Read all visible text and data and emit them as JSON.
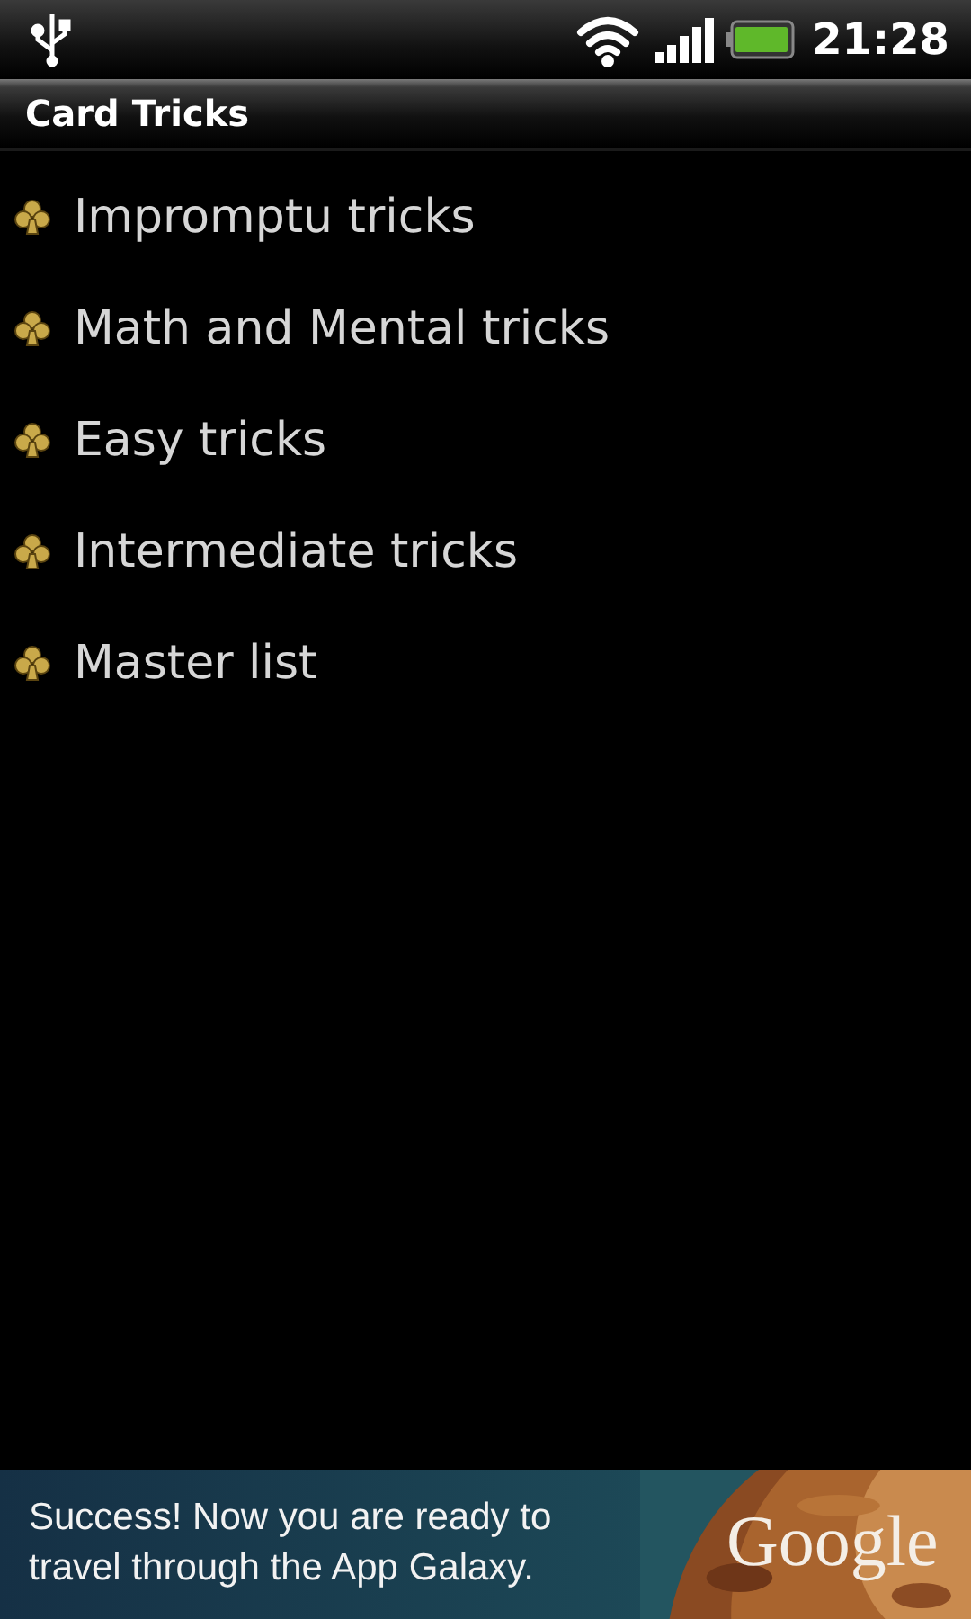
{
  "status_bar": {
    "time": "21:28"
  },
  "title_bar": {
    "title": "Card Tricks"
  },
  "list": {
    "items": [
      {
        "label": "Impromptu tricks"
      },
      {
        "label": "Math and Mental tricks"
      },
      {
        "label": "Easy tricks"
      },
      {
        "label": "Intermediate tricks"
      },
      {
        "label": "Master list"
      }
    ]
  },
  "ad_banner": {
    "message": "Success! Now you are ready to travel through the App Galaxy.",
    "brand": "Google"
  }
}
